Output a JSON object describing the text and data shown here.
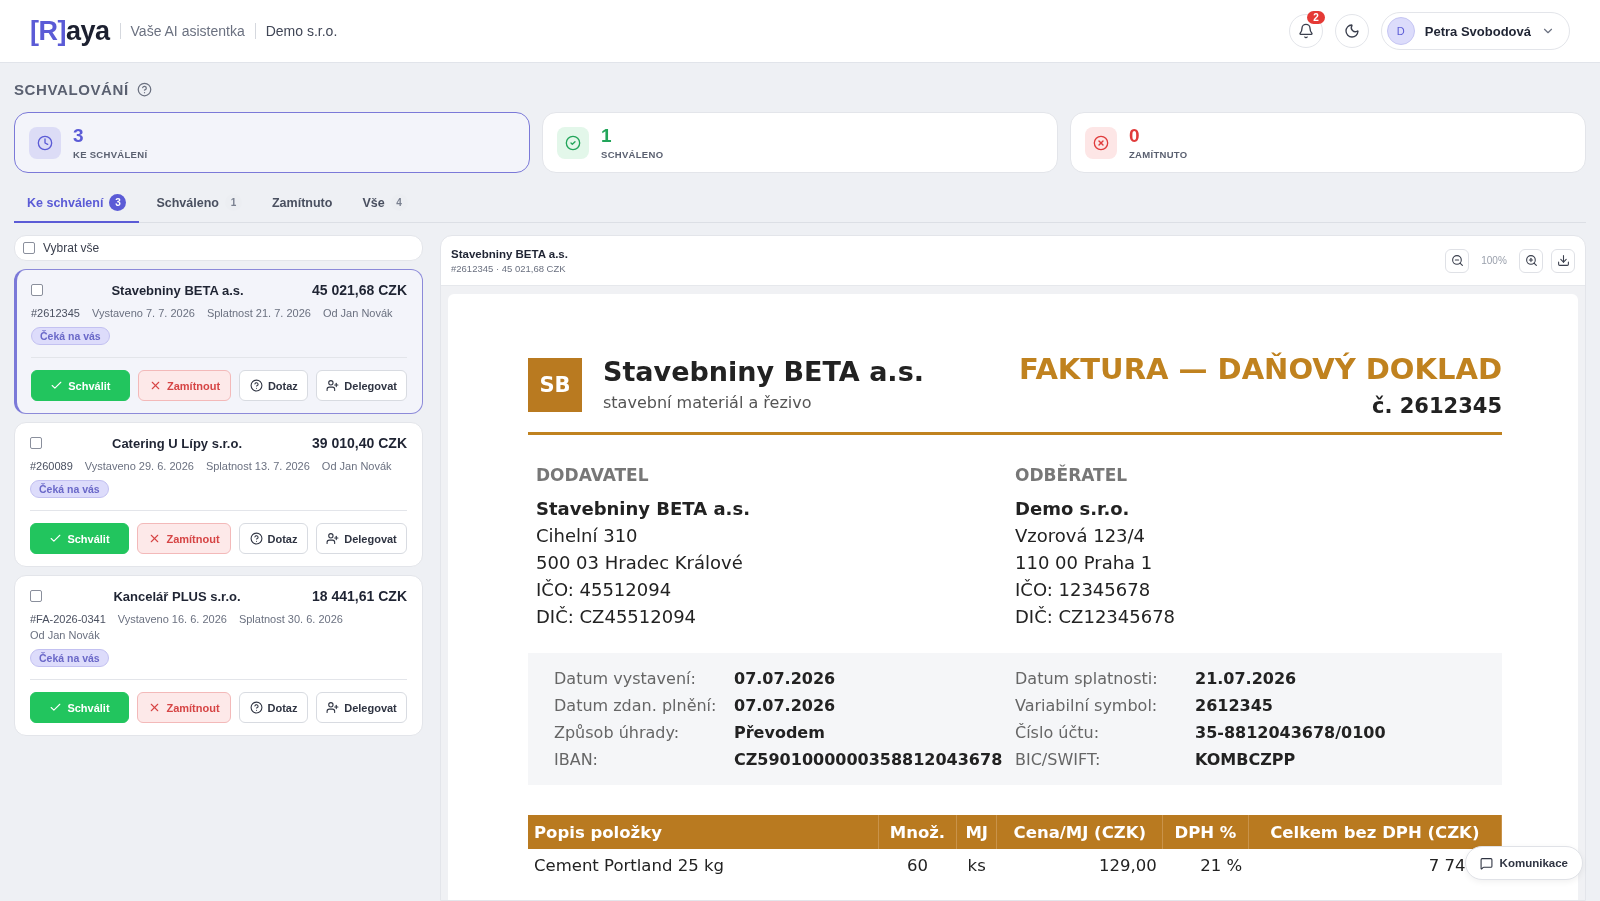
{
  "header": {
    "logo": {
      "mark": "[R]",
      "name": "aya"
    },
    "tagline": "Vaše AI asistentka",
    "company": "Demo s.r.o.",
    "notifications": {
      "count": "2"
    },
    "user": {
      "initial": "D",
      "name": "Petra Svobodová"
    }
  },
  "page": {
    "title": "SCHVALOVÁNÍ"
  },
  "stats": [
    {
      "kind": "pending",
      "value": "3",
      "label": "KE SCHVÁLENÍ",
      "selected": true
    },
    {
      "kind": "approved",
      "value": "1",
      "label": "SCHVÁLENO",
      "selected": false
    },
    {
      "kind": "rejected",
      "value": "0",
      "label": "ZAMÍTNUTO",
      "selected": false
    }
  ],
  "tabs": [
    {
      "label": "Ke schválení",
      "count": "3",
      "selected": true
    },
    {
      "label": "Schváleno",
      "count": "1",
      "selected": false
    },
    {
      "label": "Zamítnuto",
      "selected": false
    },
    {
      "label": "Vše",
      "count": "4",
      "selected": false
    }
  ],
  "select_all": {
    "label": "Vybrat vše",
    "checked": false
  },
  "invoices": [
    {
      "supplier": "Stavebniny BETA a.s.",
      "amount": "45 021,68 CZK",
      "number": "#2612345",
      "issued": "Vystaveno 7. 7. 2026",
      "due": "Splatnost 21. 7. 2026",
      "author": "Od Jan Novák",
      "status": "Čeká na vás",
      "selected": true,
      "checked": false,
      "actions": [
        {
          "kind": "approve",
          "label": "Schválit"
        },
        {
          "kind": "reject",
          "label": "Zamítnout"
        },
        {
          "kind": "ask",
          "label": "Dotaz"
        },
        {
          "kind": "delegate",
          "label": "Delegovat"
        }
      ]
    },
    {
      "supplier": "Catering U Lípy s.r.o.",
      "amount": "39 010,40 CZK",
      "number": "#260089",
      "issued": "Vystaveno 29. 6. 2026",
      "due": "Splatnost 13. 7. 2026",
      "author": "Od Jan Novák",
      "status": "Čeká na vás",
      "selected": false,
      "checked": false,
      "actions": [
        {
          "kind": "approve",
          "label": "Schválit"
        },
        {
          "kind": "reject",
          "label": "Zamítnout"
        },
        {
          "kind": "ask",
          "label": "Dotaz"
        },
        {
          "kind": "delegate",
          "label": "Delegovat"
        }
      ]
    },
    {
      "supplier": "Kancelář PLUS s.r.o.",
      "amount": "18 441,61 CZK",
      "number": "#FA-2026-0341",
      "issued": "Vystaveno 16. 6. 2026",
      "due": "Splatnost 30. 6. 2026",
      "author": "Od Jan Novák",
      "status": "Čeká na vás",
      "selected": false,
      "checked": false,
      "actions": [
        {
          "kind": "approve",
          "label": "Schválit"
        },
        {
          "kind": "reject",
          "label": "Zamítnout"
        },
        {
          "kind": "ask",
          "label": "Dotaz"
        },
        {
          "kind": "delegate",
          "label": "Delegovat"
        }
      ]
    }
  ],
  "viewer": {
    "title": "Stavebniny BETA a.s.",
    "subtitle": "#2612345 · 45 021,68 CZK",
    "zoom": "100%"
  },
  "document": {
    "logo": "SB",
    "company": "Stavebniny BETA a.s.",
    "tagline": "stavební materiál a řezivo",
    "title": "FAKTURA — DAŇOVÝ DOKLAD",
    "number": "č. 2612345",
    "parties": [
      {
        "heading": "DODAVATEL",
        "name": "Stavebniny BETA a.s.",
        "lines": [
          "Cihelní 310",
          "500 03 Hradec Králové",
          "IČO: 45512094",
          "DIČ: CZ45512094"
        ]
      },
      {
        "heading": "ODBĚRATEL",
        "name": "Demo s.r.o.",
        "lines": [
          "Vzorová 123/4",
          "110 00 Praha 1",
          "IČO: 12345678",
          "DIČ: CZ12345678"
        ]
      }
    ],
    "details": [
      [
        {
          "label": "Datum vystavení:",
          "value": "07.07.2026"
        },
        {
          "label": "Datum zdan. plnění:",
          "value": "07.07.2026"
        },
        {
          "label": "Způsob úhrady:",
          "value": "Převodem"
        },
        {
          "label": "IBAN:",
          "value": "CZ5901000000358812043678"
        }
      ],
      [
        {
          "label": "Datum splatnosti:",
          "value": "21.07.2026"
        },
        {
          "label": "Variabilní symbol:",
          "value": "2612345"
        },
        {
          "label": "Číslo účtu:",
          "value": "35-8812043678/0100"
        },
        {
          "label": "BIC/SWIFT:",
          "value": "KOMBCZPP"
        }
      ]
    ],
    "columns": [
      "Popis položky",
      "Množ.",
      "MJ",
      "Cena/MJ (CZK)",
      "DPH %",
      "Celkem bez DPH (CZK)"
    ],
    "rows": [
      [
        "Cement Portland 25 kg",
        "60",
        "ks",
        "129,00",
        "21 %",
        "7 74"
      ]
    ]
  },
  "chat_button": {
    "label": "Komunikace"
  }
}
